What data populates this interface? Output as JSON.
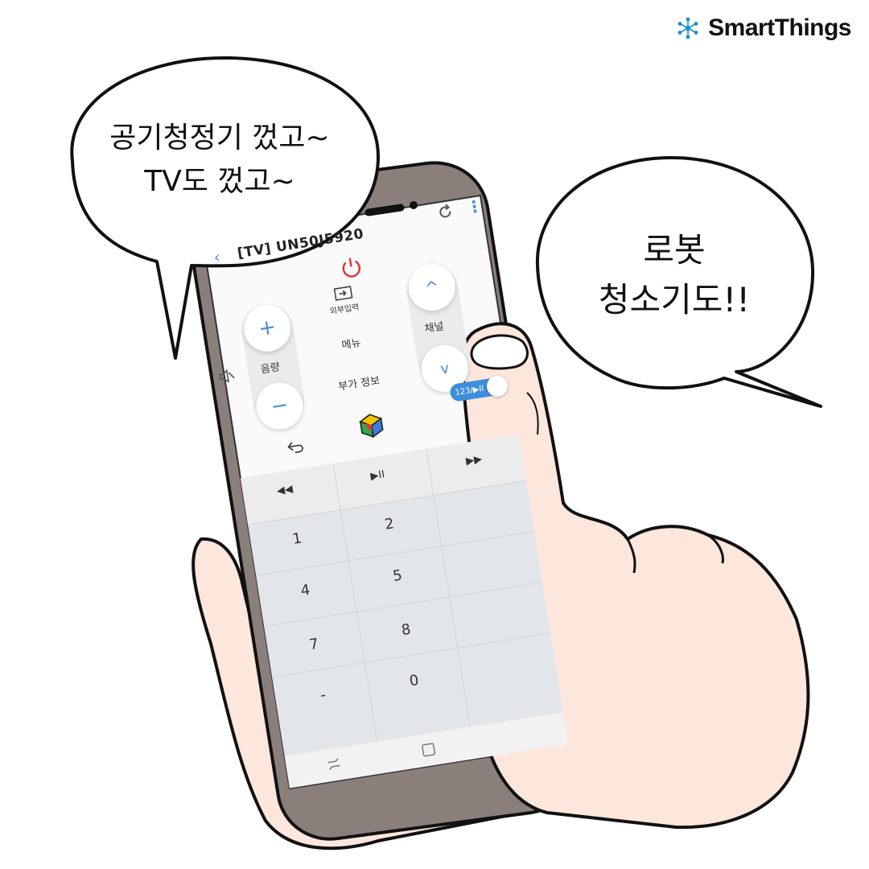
{
  "brand": {
    "name": "SmartThings",
    "logo_icon": "smartthings-hub-icon",
    "accent": "#1d8fcf"
  },
  "bubbles": {
    "left": {
      "lines": [
        "공기청정기 껐고~",
        "TV도 껐고~"
      ]
    },
    "right": {
      "lines": [
        "로봇",
        "청소기도!!"
      ]
    }
  },
  "remote": {
    "title": "[TV] UN50J5920",
    "icons": {
      "back": "back-arrow-icon",
      "refresh": "refresh-icon",
      "more": "more-vert-icon",
      "power": "power-icon"
    },
    "power_color": "#e03030",
    "accent": "#4a90d9",
    "volume_label": "음량",
    "volume_up": "+",
    "volume_down": "−",
    "mute_icon": "mute-icon",
    "source_label": "외부입력",
    "menu_label": "메뉴",
    "info_label": "부가 정보",
    "channel_label": "채널",
    "channel_up": "^",
    "channel_down": "v",
    "toggle_label": "123/▶II",
    "return_icon": "return-icon",
    "smarthub_icon": "smart-hub-cube-icon",
    "media": {
      "rewind": "◀◀",
      "play_pause": "▶II",
      "forward": "▶▶"
    },
    "keys": [
      "1",
      "2",
      "4",
      "5",
      "7",
      "8",
      "-",
      "0"
    ],
    "navbar": {
      "recent": "recent-apps-icon",
      "home": "home-square-icon"
    }
  }
}
